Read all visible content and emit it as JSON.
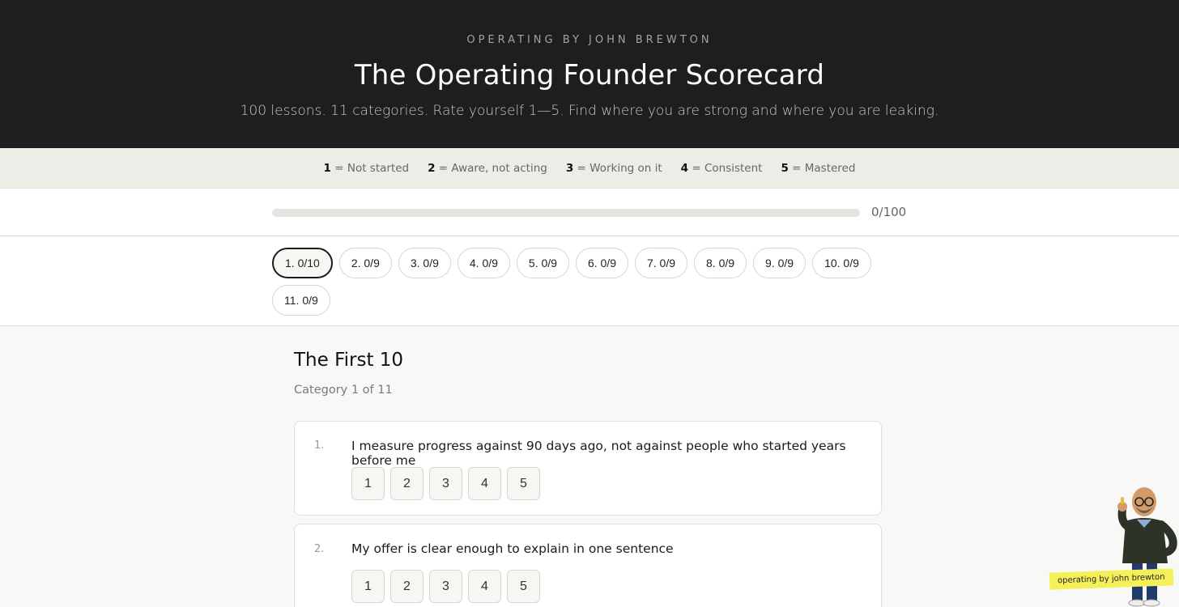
{
  "header": {
    "eyebrow": "OPERATING BY JOHN BREWTON",
    "title": "The Operating Founder Scorecard",
    "subtitle": "100 lessons. 11 categories. Rate yourself 1—5. Find where you are strong and where you are leaking."
  },
  "legend": [
    {
      "num": "1",
      "text": " = Not started"
    },
    {
      "num": "2",
      "text": " = Aware, not acting"
    },
    {
      "num": "3",
      "text": " = Working on it"
    },
    {
      "num": "4",
      "text": " = Consistent"
    },
    {
      "num": "5",
      "text": " = Mastered"
    }
  ],
  "progress": {
    "label": "0/100",
    "fraction": 0
  },
  "tabs": [
    {
      "label": "1. 0/10",
      "active": true
    },
    {
      "label": "2. 0/9"
    },
    {
      "label": "3. 0/9"
    },
    {
      "label": "4. 0/9"
    },
    {
      "label": "5. 0/9"
    },
    {
      "label": "6. 0/9"
    },
    {
      "label": "7. 0/9"
    },
    {
      "label": "8. 0/9"
    },
    {
      "label": "9. 0/9"
    },
    {
      "label": "10. 0/9"
    },
    {
      "label": "11. 0/9"
    }
  ],
  "category": {
    "title": "The First 10",
    "subtitle": "Category 1 of 11"
  },
  "questions": [
    {
      "num": "1.",
      "text": "I measure progress against 90 days ago, not against people who started years before me",
      "options": [
        "1",
        "2",
        "3",
        "4",
        "5"
      ]
    },
    {
      "num": "2.",
      "text": "My offer is clear enough to explain in one sentence",
      "options": [
        "1",
        "2",
        "3",
        "4",
        "5"
      ]
    }
  ],
  "mascot": {
    "label": "operating by john brewton",
    "icon": "cartoon-avatar-thumbs-up"
  },
  "colors": {
    "header_bg": "#1e1e1e",
    "legend_bg": "#edede8",
    "page_bg": "#f8f8f6",
    "badge_yellow": "#f5ef5a"
  }
}
